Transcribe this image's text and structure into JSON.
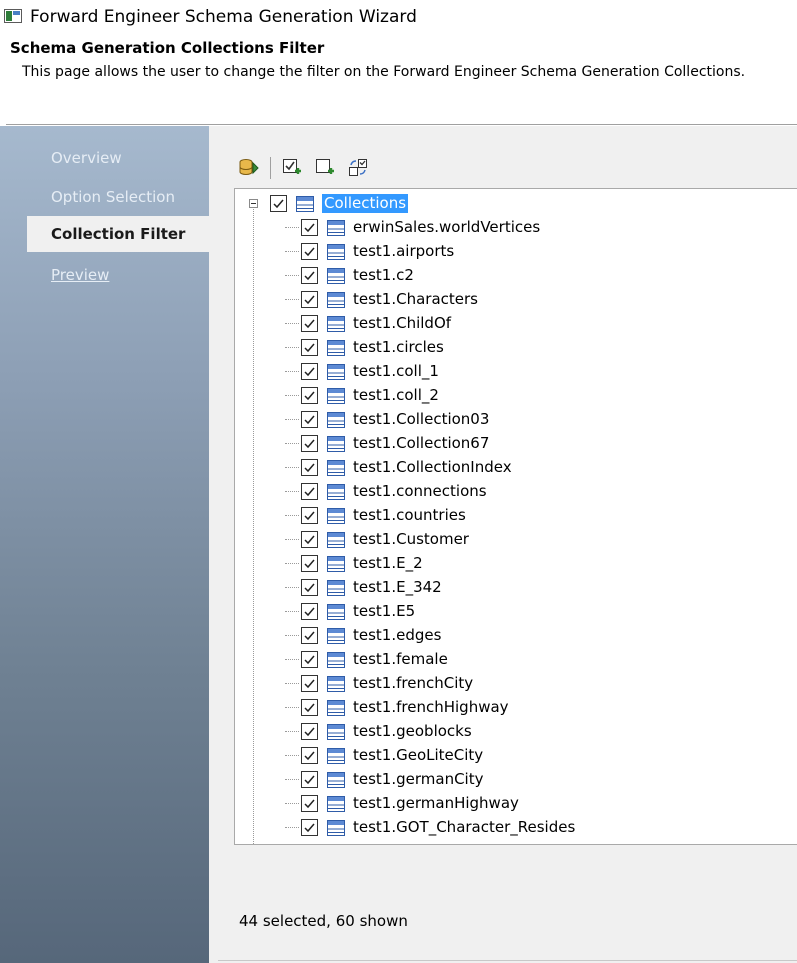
{
  "window": {
    "title": "Forward Engineer Schema Generation Wizard",
    "icon": "wizard-window-icon"
  },
  "page": {
    "heading": "Schema Generation Collections Filter",
    "description": "This page allows the user to change the filter on the Forward Engineer Schema Generation Collections."
  },
  "sidebar": {
    "items": [
      {
        "label": "Overview",
        "state": "normal"
      },
      {
        "label": "Option Selection",
        "state": "normal"
      },
      {
        "label": "Collection Filter",
        "state": "active"
      },
      {
        "label": "Preview",
        "state": "link"
      }
    ]
  },
  "toolbar": {
    "buttons": [
      {
        "name": "database-icon"
      },
      {
        "name": "check-all-icon"
      },
      {
        "name": "uncheck-all-icon"
      },
      {
        "name": "invert-selection-icon"
      }
    ]
  },
  "tree": {
    "root": {
      "label": "Collections",
      "checked": true,
      "expanded": true,
      "selected": true
    },
    "items": [
      {
        "label": "erwinSales.worldVertices",
        "checked": true
      },
      {
        "label": "test1.airports",
        "checked": true
      },
      {
        "label": "test1.c2",
        "checked": true
      },
      {
        "label": "test1.Characters",
        "checked": true
      },
      {
        "label": "test1.ChildOf",
        "checked": true
      },
      {
        "label": "test1.circles",
        "checked": true
      },
      {
        "label": "test1.coll_1",
        "checked": true
      },
      {
        "label": "test1.coll_2",
        "checked": true
      },
      {
        "label": "test1.Collection03",
        "checked": true
      },
      {
        "label": "test1.Collection67",
        "checked": true
      },
      {
        "label": "test1.CollectionIndex",
        "checked": true
      },
      {
        "label": "test1.connections",
        "checked": true
      },
      {
        "label": "test1.countries",
        "checked": true
      },
      {
        "label": "test1.Customer",
        "checked": true
      },
      {
        "label": "test1.E_2",
        "checked": true
      },
      {
        "label": "test1.E_342",
        "checked": true
      },
      {
        "label": "test1.E5",
        "checked": true
      },
      {
        "label": "test1.edges",
        "checked": true
      },
      {
        "label": "test1.female",
        "checked": true
      },
      {
        "label": "test1.frenchCity",
        "checked": true
      },
      {
        "label": "test1.frenchHighway",
        "checked": true
      },
      {
        "label": "test1.geoblocks",
        "checked": true
      },
      {
        "label": "test1.GeoLiteCity",
        "checked": true
      },
      {
        "label": "test1.germanCity",
        "checked": true
      },
      {
        "label": "test1.germanHighway",
        "checked": true
      },
      {
        "label": "test1.GOT_Character_Resides",
        "checked": true
      }
    ]
  },
  "status": {
    "text": "44 selected, 60 shown"
  },
  "colors": {
    "selection": "#3399ff",
    "sidebar_top": "#a6b9ce",
    "sidebar_bottom": "#56677a",
    "panel": "#f0f0f0"
  }
}
